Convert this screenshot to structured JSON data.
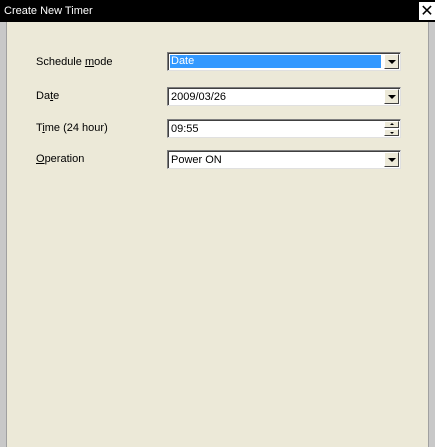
{
  "window": {
    "title": "Create New Timer",
    "close_glyph": "✕"
  },
  "form": {
    "schedule_mode": {
      "label_pre": "Schedule ",
      "label_mn": "m",
      "label_post": "ode",
      "value": "Date"
    },
    "date": {
      "label_pre": "Da",
      "label_mn": "t",
      "label_post": "e",
      "value": "2009/03/26"
    },
    "time": {
      "label_pre": "T",
      "label_mn": "i",
      "label_post": "me (24 hour)",
      "value": "09:55"
    },
    "operation": {
      "label_pre": "",
      "label_mn": "O",
      "label_post": "peration",
      "value": "Power ON"
    }
  }
}
